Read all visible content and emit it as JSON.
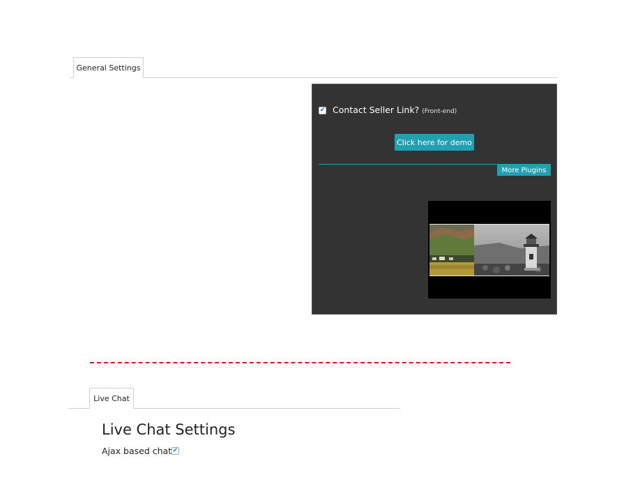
{
  "general_tab": {
    "label": "General Settings"
  },
  "panel": {
    "contact_seller": {
      "label": "Contact Seller Link?",
      "note": "(Front-end)",
      "checked": true
    },
    "demo_button": "Click here for demo",
    "more_plugins": "More Plugins",
    "accent_color": "#21a0b1",
    "background_color": "#333333"
  },
  "live_chat_tab": {
    "label": "Live Chat"
  },
  "live_chat": {
    "title": "Live Chat Settings",
    "ajax_label": "Ajax based chat",
    "ajax_checked": true
  },
  "divider_color": "#d41a1a"
}
